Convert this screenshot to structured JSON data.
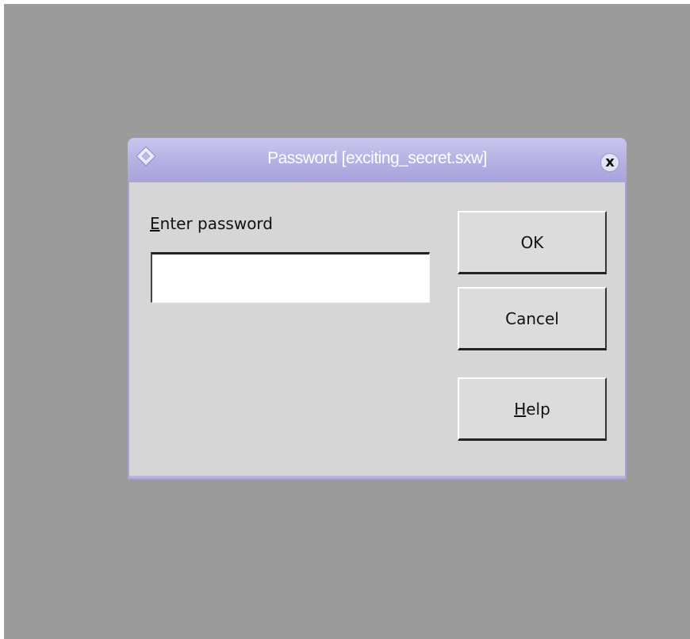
{
  "desktop": {
    "background_color": "#9b9b9b"
  },
  "dialog": {
    "title": "Password [exciting_secret.sxw]",
    "app_icon": "diamond-app-icon",
    "close_icon": "close-icon",
    "close_label": "x",
    "titlebar_color": "#b2aee2",
    "body_color": "#d6d6d6"
  },
  "password_field": {
    "label_mnemonic": "E",
    "label_rest": "nter password",
    "value": ""
  },
  "buttons": {
    "ok_label": "OK",
    "cancel_label": "Cancel",
    "help_mnemonic": "H",
    "help_rest": "elp"
  }
}
